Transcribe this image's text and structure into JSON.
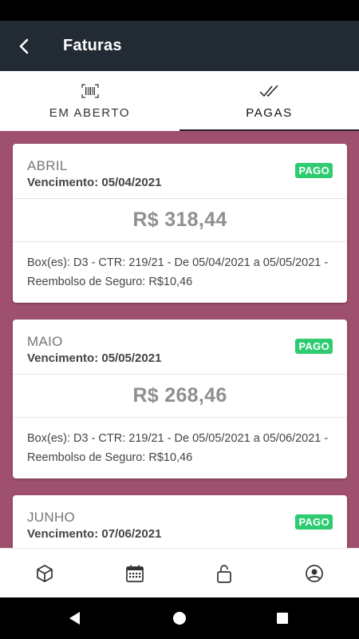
{
  "app_bar": {
    "title": "Faturas",
    "back_icon": "arrow-back-icon"
  },
  "tabs": [
    {
      "label": "EM ABERTO",
      "icon": "barcode-icon",
      "active": false
    },
    {
      "label": "PAGAS",
      "icon": "double-check-icon",
      "active": true
    }
  ],
  "invoices": [
    {
      "month": "ABRIL",
      "due": "Vencimento: 05/04/2021",
      "status": "PAGO",
      "amount": "R$ 318,44",
      "description": "Box(es): D3 - CTR: 219/21 - De 05/04/2021 a 05/05/2021 - Reembolso de Seguro: R$10,46"
    },
    {
      "month": "MAIO",
      "due": "Vencimento: 05/05/2021",
      "status": "PAGO",
      "amount": "R$ 268,46",
      "description": "Box(es): D3 - CTR: 219/21 - De 05/05/2021 a 05/06/2021 - Reembolso de Seguro: R$10,46"
    },
    {
      "month": "JUNHO",
      "due": "Vencimento: 07/06/2021",
      "status": "PAGO"
    }
  ],
  "bottom_nav": [
    "box-icon",
    "calendar-icon",
    "unlock-icon",
    "account-circle-icon"
  ],
  "system_nav": [
    "back-triangle-icon",
    "home-circle-icon",
    "recents-square-icon"
  ],
  "colors": {
    "app_bar": "#222b33",
    "content_background": "#a0506f",
    "badge": "#2ecc71",
    "amount_text": "#8f8f8f"
  }
}
